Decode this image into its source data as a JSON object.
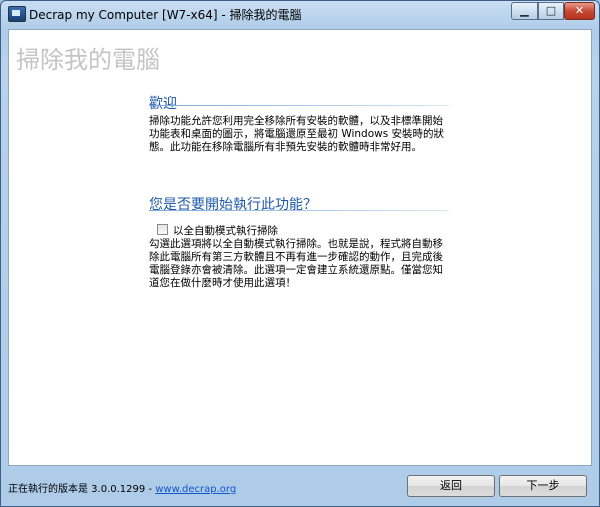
{
  "window": {
    "title": "Decrap my Computer [W7-x64] - 掃除我的電腦",
    "controls": {
      "minimize": "▁",
      "maximize": "□",
      "close": "✕"
    }
  },
  "page": {
    "title": "掃除我的電腦"
  },
  "welcome": {
    "heading": "歡迎",
    "text": "掃除功能允許您利用完全移除所有安裝的軟體，以及非標準開始功能表和桌面的圖示，將電腦還原至最初 Windows 安裝時的狀態。此功能在移除電腦所有非預先安裝的軟體時非常好用。"
  },
  "start": {
    "heading": "您是否要開始執行此功能？",
    "checkbox_label": "以全自動模式執行掃除",
    "checkbox_checked": false,
    "text": "勾選此選項將以全自動模式執行掃除。也就是說，程式將自動移除此電腦所有第三方軟體且不再有進一步確認的動作，且完成後電腦登錄亦會被清除。此選項一定會建立系統還原點。僅當您知道您在做什麼時才使用此選項！"
  },
  "footer": {
    "version_text": "正在執行的版本是 3.0.0.1299 - ",
    "link_text": "www.decrap.org",
    "back_button": "返回",
    "next_button": "下一步"
  }
}
